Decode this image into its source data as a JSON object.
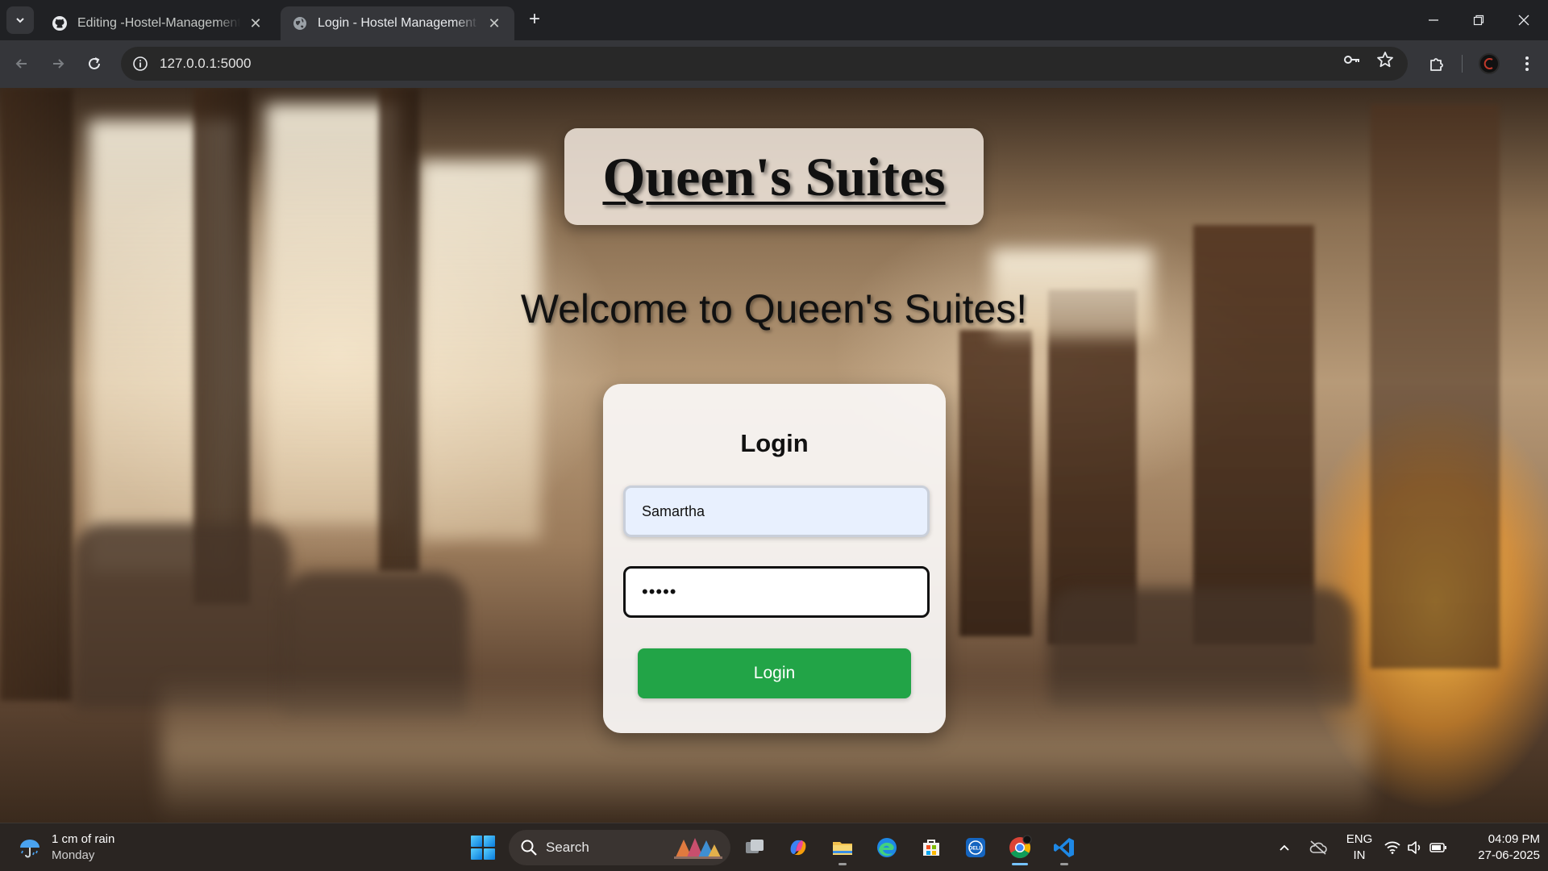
{
  "browser": {
    "tabs": [
      {
        "title": "Editing -Hostel-Management-S",
        "icon": "github-icon",
        "active": false
      },
      {
        "title": "Login - Hostel Management Sy",
        "icon": "globe-icon",
        "active": true
      }
    ],
    "url": "127.0.0.1:5000"
  },
  "page": {
    "brand": "Queen's Suites",
    "welcome": "Welcome to Queen's Suites!",
    "login": {
      "heading": "Login",
      "username_value": "Samartha",
      "password_value": "•••••",
      "button_label": "Login"
    }
  },
  "taskbar": {
    "weather": {
      "line1": "1 cm of rain",
      "line2": "Monday"
    },
    "search_label": "Search",
    "language": {
      "line1": "ENG",
      "line2": "IN"
    },
    "clock": {
      "time": "04:09 PM",
      "date": "27-06-2025"
    }
  },
  "colors": {
    "login_button": "#22a447",
    "tab_strip": "#202124",
    "toolbar": "#35363a",
    "taskbar": "#2a2522"
  }
}
